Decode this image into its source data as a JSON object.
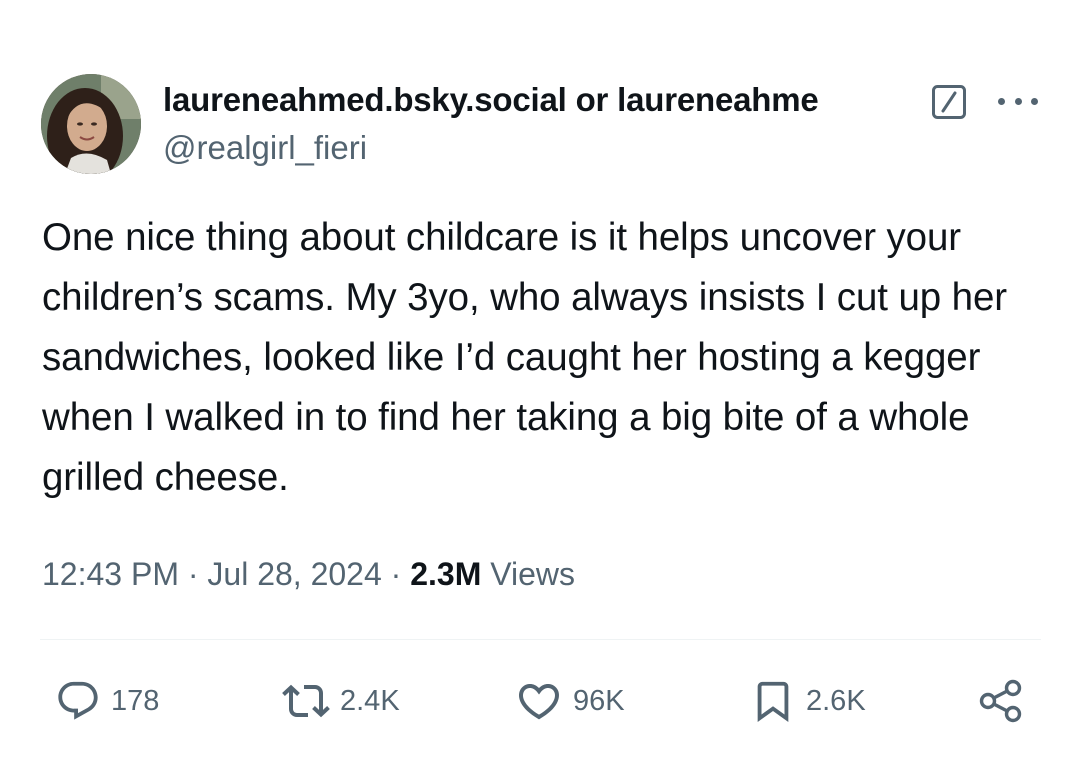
{
  "author": {
    "display_name": "laureneahmed.bsky.social or laureneahme",
    "handle": "@realgirl_fieri",
    "badge_icon": "square-slash-icon",
    "more_icon": "ellipsis-icon"
  },
  "tweet": {
    "text": "One nice thing about childcare is it helps uncover your children’s scams. My 3yo, who always insists I cut up her sandwiches, looked like I’d caught her hosting a kegger when I walked in to find her taking a big bite of a whole grilled cheese.",
    "time": "12:43 PM",
    "separator": " · ",
    "date": "Jul 28, 2024",
    "views_count": "2.3M",
    "views_label": " Views"
  },
  "actions": {
    "reply": {
      "icon": "reply-icon",
      "count": "178"
    },
    "retweet": {
      "icon": "retweet-icon",
      "count": "2.4K"
    },
    "like": {
      "icon": "heart-icon",
      "count": "96K"
    },
    "bookmark": {
      "icon": "bookmark-icon",
      "count": "2.6K"
    },
    "share": {
      "icon": "share-icon"
    }
  },
  "colors": {
    "text_primary": "#0f1419",
    "text_secondary": "#536471",
    "divider": "#eff3f4"
  }
}
